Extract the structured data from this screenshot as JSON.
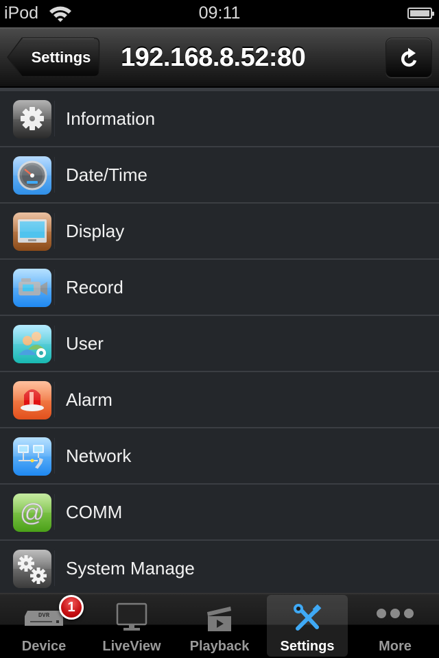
{
  "status_bar": {
    "carrier": "iPod",
    "time": "09:11",
    "wifi_icon": "wifi-icon",
    "battery_icon": "battery-icon",
    "battery_level": 1.0
  },
  "nav_bar": {
    "back_label": "Settings",
    "title": "192.168.8.52:80",
    "refresh_icon": "refresh-icon"
  },
  "settings": {
    "items": [
      {
        "label": "Information",
        "icon": "gear-icon"
      },
      {
        "label": "Date/Time",
        "icon": "gauge-icon"
      },
      {
        "label": "Display",
        "icon": "monitor-icon"
      },
      {
        "label": "Record",
        "icon": "video-camera-icon"
      },
      {
        "label": "User",
        "icon": "users-icon"
      },
      {
        "label": "Alarm",
        "icon": "siren-icon"
      },
      {
        "label": "Network",
        "icon": "network-icon"
      },
      {
        "label": "COMM",
        "icon": "at-sign-icon"
      },
      {
        "label": "System Manage",
        "icon": "gears-icon"
      }
    ]
  },
  "tab_bar": {
    "active": "Settings",
    "tabs": [
      {
        "label": "Device",
        "icon": "dvr-icon",
        "badge": "1"
      },
      {
        "label": "LiveView",
        "icon": "monitor-icon"
      },
      {
        "label": "Playback",
        "icon": "clapperboard-icon"
      },
      {
        "label": "Settings",
        "icon": "tools-icon"
      },
      {
        "label": "More",
        "icon": "more-dots-icon"
      }
    ],
    "dvr_text": "DVR"
  },
  "colors": {
    "list_background": "#24272b",
    "separator": "#3b3e43",
    "active_tab_icon": "#3fa9f5",
    "badge": "#d0161a"
  }
}
